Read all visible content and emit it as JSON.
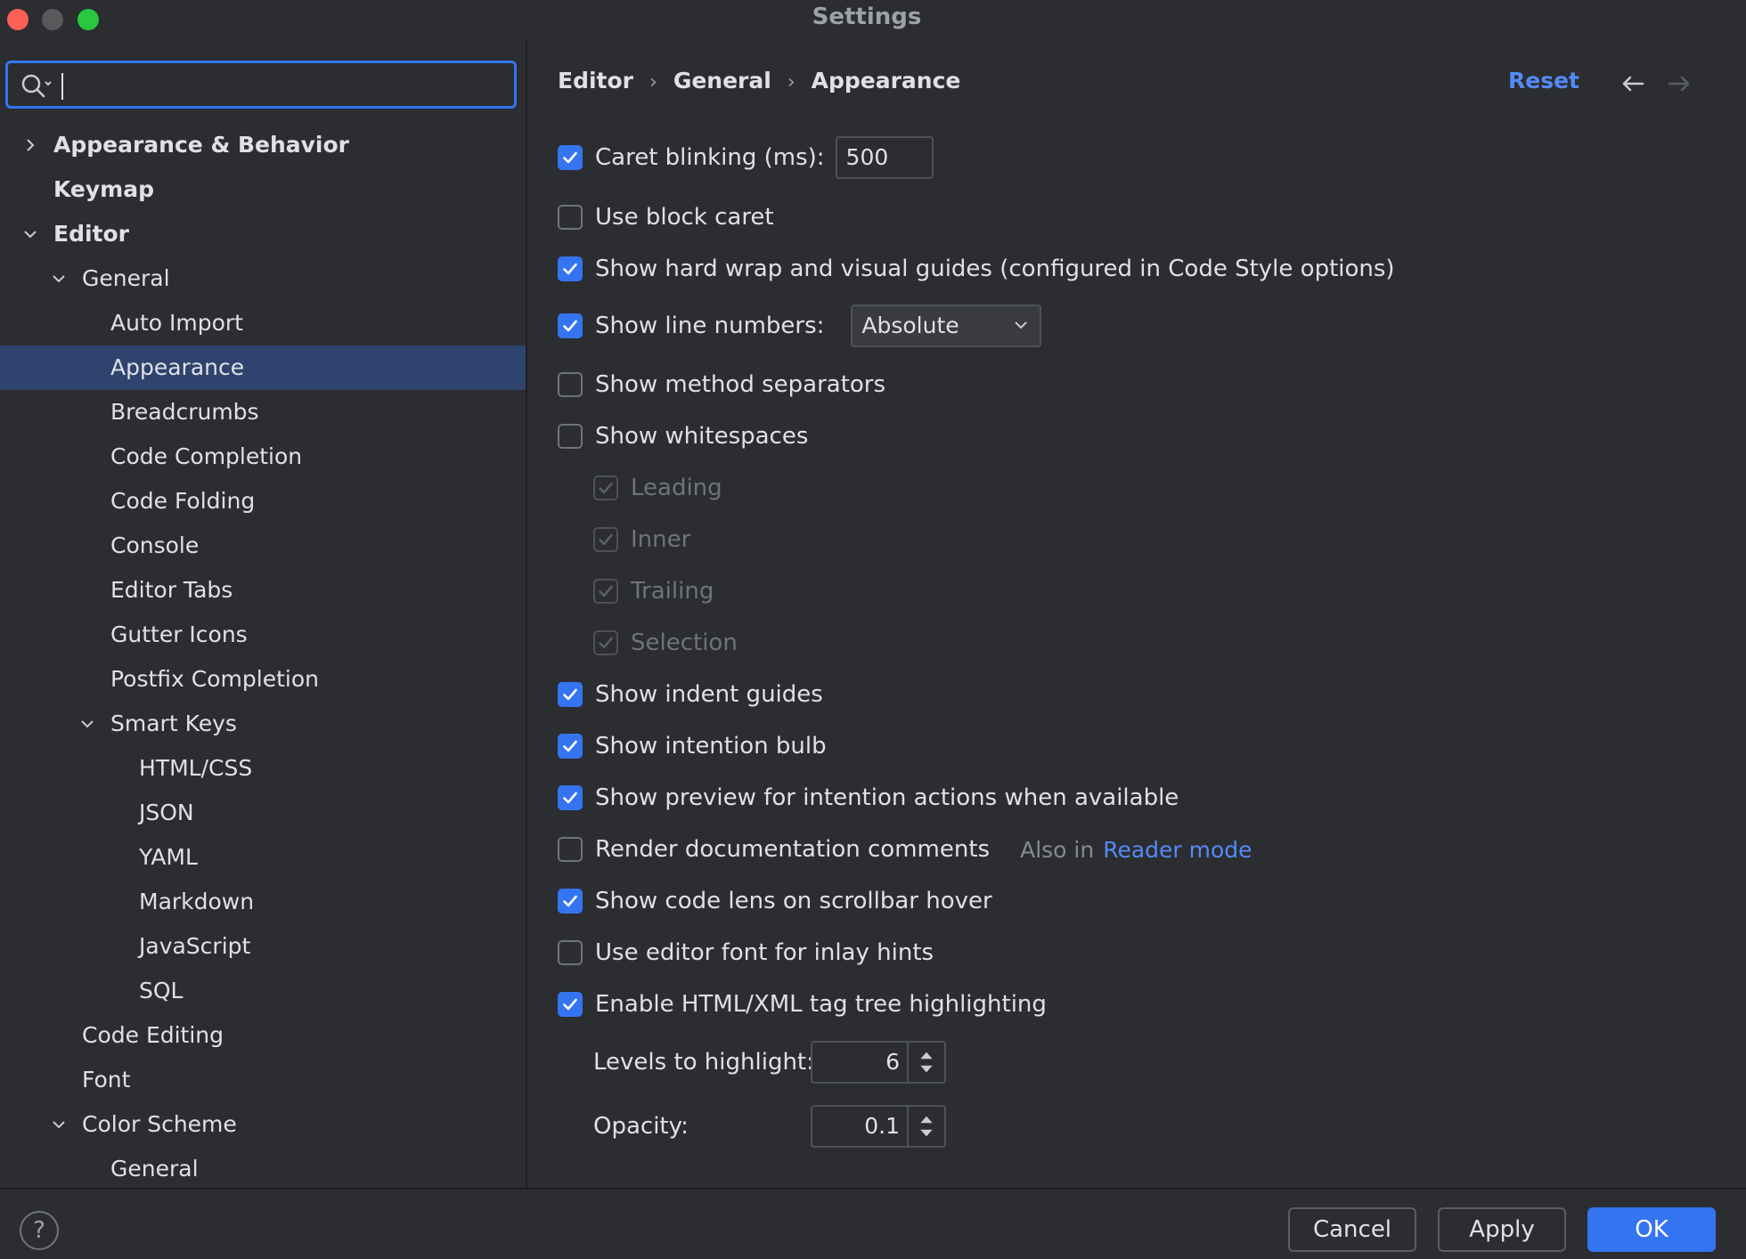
{
  "window": {
    "title": "Settings"
  },
  "search": {
    "value": "",
    "placeholder": ""
  },
  "tree": [
    {
      "label": "Appearance & Behavior",
      "bold": true,
      "indent": 0,
      "chevron": "right",
      "selected": false
    },
    {
      "label": "Keymap",
      "bold": true,
      "indent": 0,
      "chevron": "none",
      "selected": false
    },
    {
      "label": "Editor",
      "bold": true,
      "indent": 0,
      "chevron": "down",
      "selected": false
    },
    {
      "label": "General",
      "bold": false,
      "indent": 1,
      "chevron": "down",
      "selected": false
    },
    {
      "label": "Auto Import",
      "bold": false,
      "indent": 2,
      "chevron": "none",
      "selected": false
    },
    {
      "label": "Appearance",
      "bold": false,
      "indent": 2,
      "chevron": "none",
      "selected": true
    },
    {
      "label": "Breadcrumbs",
      "bold": false,
      "indent": 2,
      "chevron": "none",
      "selected": false
    },
    {
      "label": "Code Completion",
      "bold": false,
      "indent": 2,
      "chevron": "none",
      "selected": false
    },
    {
      "label": "Code Folding",
      "bold": false,
      "indent": 2,
      "chevron": "none",
      "selected": false
    },
    {
      "label": "Console",
      "bold": false,
      "indent": 2,
      "chevron": "none",
      "selected": false
    },
    {
      "label": "Editor Tabs",
      "bold": false,
      "indent": 2,
      "chevron": "none",
      "selected": false
    },
    {
      "label": "Gutter Icons",
      "bold": false,
      "indent": 2,
      "chevron": "none",
      "selected": false
    },
    {
      "label": "Postfix Completion",
      "bold": false,
      "indent": 2,
      "chevron": "none",
      "selected": false
    },
    {
      "label": "Smart Keys",
      "bold": false,
      "indent": 2,
      "chevron": "down",
      "selected": false
    },
    {
      "label": "HTML/CSS",
      "bold": false,
      "indent": 3,
      "chevron": "none",
      "selected": false
    },
    {
      "label": "JSON",
      "bold": false,
      "indent": 3,
      "chevron": "none",
      "selected": false
    },
    {
      "label": "YAML",
      "bold": false,
      "indent": 3,
      "chevron": "none",
      "selected": false
    },
    {
      "label": "Markdown",
      "bold": false,
      "indent": 3,
      "chevron": "none",
      "selected": false
    },
    {
      "label": "JavaScript",
      "bold": false,
      "indent": 3,
      "chevron": "none",
      "selected": false
    },
    {
      "label": "SQL",
      "bold": false,
      "indent": 3,
      "chevron": "none",
      "selected": false
    },
    {
      "label": "Code Editing",
      "bold": false,
      "indent": 1,
      "chevron": "none",
      "selected": false
    },
    {
      "label": "Font",
      "bold": false,
      "indent": 1,
      "chevron": "none",
      "selected": false
    },
    {
      "label": "Color Scheme",
      "bold": false,
      "indent": 1,
      "chevron": "down",
      "selected": false
    },
    {
      "label": "General",
      "bold": false,
      "indent": 2,
      "chevron": "none",
      "selected": false
    }
  ],
  "breadcrumb": {
    "items": [
      "Editor",
      "General",
      "Appearance"
    ],
    "separator": "›"
  },
  "header": {
    "reset_label": "Reset"
  },
  "options": {
    "caret_blinking": {
      "label": "Caret blinking (ms):",
      "checked": true,
      "value": "500"
    },
    "block_caret": {
      "label": "Use block caret",
      "checked": false
    },
    "hard_wrap": {
      "label": "Show hard wrap and visual guides (configured in Code Style options)",
      "checked": true
    },
    "line_numbers": {
      "label": "Show line numbers:",
      "checked": true,
      "selected": "Absolute"
    },
    "method_separators": {
      "label": "Show method separators",
      "checked": false
    },
    "whitespaces": {
      "label": "Show whitespaces",
      "checked": false
    },
    "ws_leading": {
      "label": "Leading",
      "checked": true,
      "disabled": true
    },
    "ws_inner": {
      "label": "Inner",
      "checked": true,
      "disabled": true
    },
    "ws_trailing": {
      "label": "Trailing",
      "checked": true,
      "disabled": true
    },
    "ws_selection": {
      "label": "Selection",
      "checked": true,
      "disabled": true
    },
    "indent_guides": {
      "label": "Show indent guides",
      "checked": true
    },
    "intention_bulb": {
      "label": "Show intention bulb",
      "checked": true
    },
    "preview_intention": {
      "label": "Show preview for intention actions when available",
      "checked": true
    },
    "render_docs": {
      "label": "Render documentation comments",
      "checked": false,
      "hint": "Also in",
      "link": "Reader mode"
    },
    "code_lens": {
      "label": "Show code lens on scrollbar hover",
      "checked": true
    },
    "editor_font_inlay": {
      "label": "Use editor font for inlay hints",
      "checked": false
    },
    "tag_tree": {
      "label": "Enable HTML/XML tag tree highlighting",
      "checked": true
    },
    "levels": {
      "label": "Levels to highlight:",
      "value": "6"
    },
    "opacity": {
      "label": "Opacity:",
      "value": "0.1"
    }
  },
  "footer": {
    "help_label": "?",
    "cancel_label": "Cancel",
    "apply_label": "Apply",
    "ok_label": "OK"
  },
  "colors": {
    "accent": "#3574f0",
    "link": "#548af7",
    "selection": "#2e436e",
    "background": "#2b2d30"
  }
}
